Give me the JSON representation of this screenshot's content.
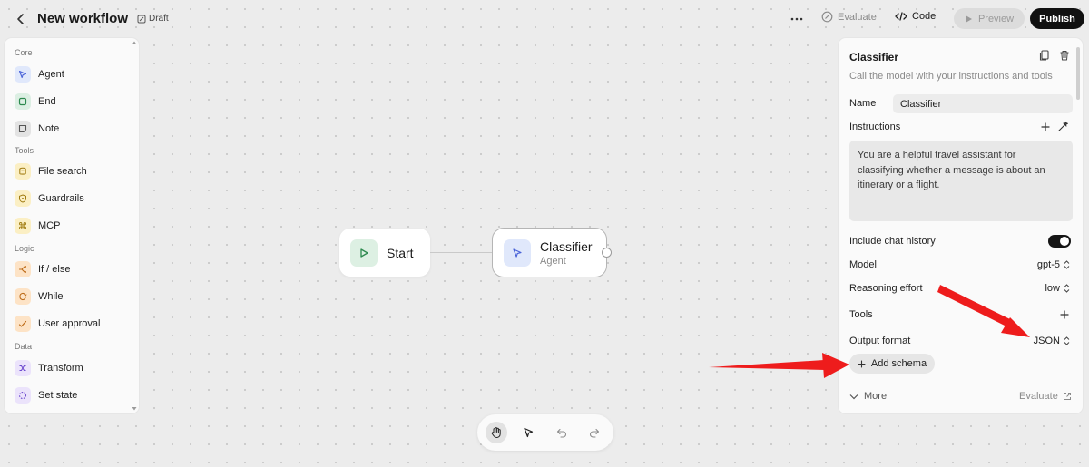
{
  "header": {
    "title": "New workflow",
    "status": "Draft",
    "evaluate_label": "Evaluate",
    "code_label": "Code",
    "preview_label": "Preview",
    "publish_label": "Publish"
  },
  "palette": {
    "sections": [
      "Core",
      "Tools",
      "Logic",
      "Data"
    ],
    "items": [
      {
        "label": "Agent",
        "icon": "cursor-icon",
        "color": "#e0e8fb"
      },
      {
        "label": "End",
        "icon": "stop-square-icon",
        "color": "#dcefe3"
      },
      {
        "label": "Note",
        "icon": "note-icon",
        "color": "#e3e3e3"
      },
      {
        "label": "File search",
        "icon": "database-icon",
        "color": "#fbefc4"
      },
      {
        "label": "Guardrails",
        "icon": "shield-icon",
        "color": "#fbefc4"
      },
      {
        "label": "MCP",
        "icon": "command-icon",
        "color": "#fbefc4"
      },
      {
        "label": "If / else",
        "icon": "branch-icon",
        "color": "#fde3c6"
      },
      {
        "label": "While",
        "icon": "loop-icon",
        "color": "#fde3c6"
      },
      {
        "label": "User approval",
        "icon": "approval-icon",
        "color": "#fde3c6"
      },
      {
        "label": "Transform",
        "icon": "shuffle-icon",
        "color": "#ebe3fb"
      },
      {
        "label": "Set state",
        "icon": "dashed-circle-icon",
        "color": "#ebe3fb"
      }
    ]
  },
  "canvas": {
    "start_node": {
      "label": "Start"
    },
    "classifier_node": {
      "label": "Classifier",
      "type": "Agent"
    }
  },
  "panel": {
    "title": "Classifier",
    "description": "Call the model with your instructions and tools",
    "name_label": "Name",
    "name_value": "Classifier",
    "instructions_label": "Instructions",
    "instructions_text": "You are a helpful travel assistant for classifying whether a message is about an itinerary or a flight.",
    "chat_history_label": "Include chat history",
    "chat_history_enabled": true,
    "model_label": "Model",
    "model_value": "gpt-5",
    "reasoning_label": "Reasoning effort",
    "reasoning_value": "low",
    "tools_label": "Tools",
    "output_format_label": "Output format",
    "output_format_value": "JSON",
    "add_schema_label": "Add schema",
    "more_label": "More",
    "evaluate_label": "Evaluate"
  },
  "annotation_color": "#ee1c1c"
}
